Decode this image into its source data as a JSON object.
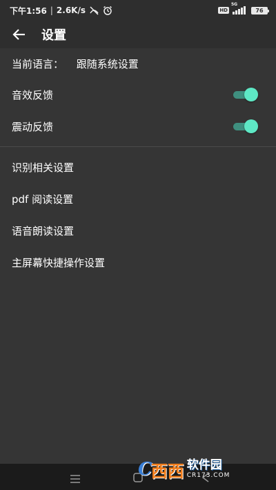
{
  "status_bar": {
    "time": "下午1:56",
    "separator": "|",
    "network_speed": "2.6K/s",
    "hd_badge": "HD",
    "signal_label": "5G",
    "battery_level": "76",
    "icons": [
      "muted-alarm-icon",
      "alarm-clock-icon",
      "hd-icon",
      "signal-icon",
      "battery-icon"
    ]
  },
  "app_bar": {
    "title": "设置",
    "back_icon": "arrow-left-icon"
  },
  "settings": {
    "language": {
      "label": "当前语言：",
      "value": "跟随系统设置"
    },
    "sound_feedback": {
      "label": "音效反馈",
      "enabled": true
    },
    "vibration_feedback": {
      "label": "震动反馈",
      "enabled": true
    },
    "items": [
      {
        "label": "识别相关设置"
      },
      {
        "label": "pdf 阅读设置"
      },
      {
        "label": "语音朗读设置"
      },
      {
        "label": "主屏幕快捷操作设置"
      }
    ]
  },
  "nav_bar": {
    "icons": [
      "menu-icon",
      "home-icon",
      "back-icon"
    ]
  },
  "watermark": {
    "logo": "C",
    "logo_suffix": "西西",
    "name": "软件园",
    "domain": "CR173.COM"
  },
  "colors": {
    "background": "#353535",
    "toolbar": "#2e2e2e",
    "switch_track": "#3f8f7f",
    "switch_thumb": "#5ee8c5",
    "nav_bar": "#1b1b1b"
  }
}
